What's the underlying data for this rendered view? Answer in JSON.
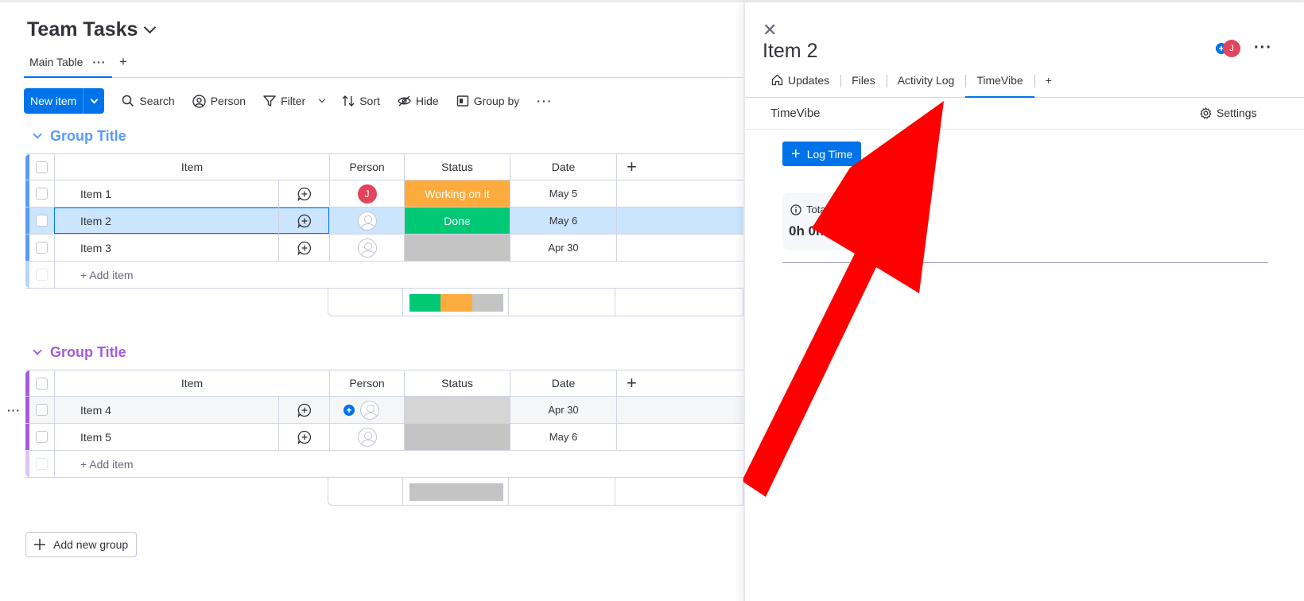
{
  "board": {
    "title": "Team Tasks",
    "view_tab": "Main Table",
    "view_tab_more": "···",
    "add_view": "+"
  },
  "toolbar": {
    "new_item": "New item",
    "search": "Search",
    "person": "Person",
    "filter": "Filter",
    "sort": "Sort",
    "hide": "Hide",
    "group_by": "Group by",
    "more": "···"
  },
  "columns": {
    "item": "Item",
    "person": "Person",
    "status": "Status",
    "date": "Date",
    "add": "+"
  },
  "groups": [
    {
      "title": "Group Title",
      "color": "#579bfc",
      "rows": [
        {
          "name": "Item 1",
          "person": "J",
          "status": "Working on it",
          "status_color": "#fdab3d",
          "date": "May 5"
        },
        {
          "name": "Item 2",
          "person": "",
          "status": "Done",
          "status_color": "#00c875",
          "date": "May 6"
        },
        {
          "name": "Item 3",
          "person": "",
          "status": "",
          "status_color": "#c4c4c4",
          "date": "Apr 30"
        }
      ],
      "add_item": "+ Add item",
      "status_summary": [
        {
          "color": "#00c875",
          "fraction": 0.333
        },
        {
          "color": "#fdab3d",
          "fraction": 0.333
        },
        {
          "color": "#c4c4c4",
          "fraction": 0.334
        }
      ]
    },
    {
      "title": "Group Title",
      "color": "#a25ddc",
      "rows": [
        {
          "name": "Item 4",
          "person": "",
          "status": "",
          "status_color": "#c4c4c4",
          "date": "Apr 30"
        },
        {
          "name": "Item 5",
          "person": "",
          "status": "",
          "status_color": "#c4c4c4",
          "date": "May 6"
        }
      ],
      "add_item": "+ Add item",
      "status_summary": [
        {
          "color": "#c4c4c4",
          "fraction": 1.0
        }
      ]
    }
  ],
  "add_group": "Add new group",
  "panel": {
    "title": "Item 2",
    "avatar": "J",
    "more": "···",
    "tabs": [
      "Updates",
      "Files",
      "Activity Log",
      "TimeVibe",
      "+"
    ],
    "active_tab": "TimeVibe",
    "app_name": "TimeVibe",
    "settings": "Settings",
    "log_time": "Log Time",
    "total_label": "Total Logged",
    "total_value": "0h 0m"
  },
  "colors": {
    "primary": "#0073ea",
    "selected_row": "#cce5ff",
    "annotation_arrow": "#ff0000"
  }
}
